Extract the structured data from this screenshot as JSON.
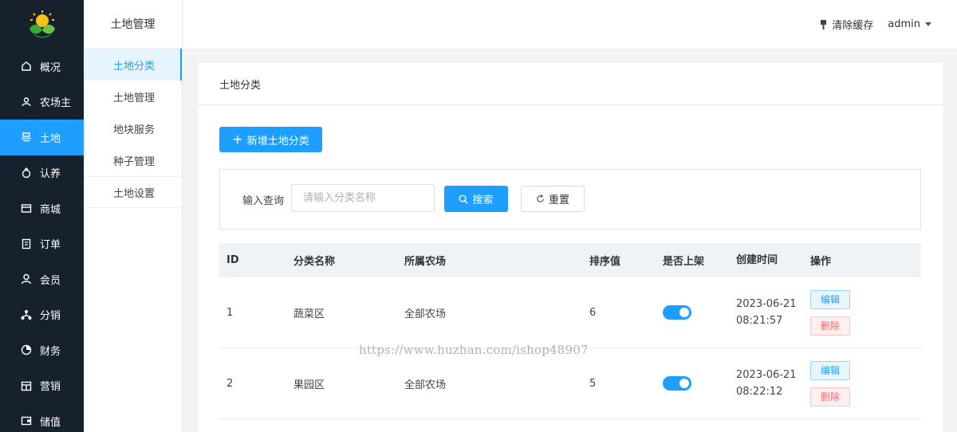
{
  "colors": {
    "sidebar_bg": "#16212d",
    "accent": "#1e9fff",
    "danger": "#f56c6c"
  },
  "sidebar": {
    "items": [
      {
        "label": "概况",
        "icon": "home-icon",
        "active": false
      },
      {
        "label": "农场主",
        "icon": "farmer-icon",
        "active": false
      },
      {
        "label": "土地",
        "icon": "land-icon",
        "active": true
      },
      {
        "label": "认养",
        "icon": "adopt-icon",
        "active": false
      },
      {
        "label": "商城",
        "icon": "shop-icon",
        "active": false
      },
      {
        "label": "订单",
        "icon": "order-icon",
        "active": false
      },
      {
        "label": "会员",
        "icon": "member-icon",
        "active": false
      },
      {
        "label": "分销",
        "icon": "distribution-icon",
        "active": false
      },
      {
        "label": "财务",
        "icon": "finance-icon",
        "active": false
      },
      {
        "label": "营销",
        "icon": "marketing-icon",
        "active": false
      },
      {
        "label": "储值",
        "icon": "wallet-icon",
        "active": false
      }
    ]
  },
  "submenu": {
    "title": "土地管理",
    "items": [
      {
        "label": "土地分类",
        "active": true
      },
      {
        "label": "土地管理",
        "active": false
      },
      {
        "label": "地块服务",
        "active": false
      },
      {
        "label": "种子管理",
        "active": false
      },
      {
        "label": "土地设置",
        "active": false
      }
    ]
  },
  "header": {
    "clear_cache": "清除缓存",
    "user": "admin"
  },
  "main": {
    "card_title": "土地分类",
    "add_button": "新增土地分类",
    "search": {
      "label": "输入查询",
      "placeholder": "请输入分类名称",
      "value": "",
      "search_button": "搜索",
      "reset_button": "重置"
    },
    "table": {
      "columns": [
        "ID",
        "分类名称",
        "所属农场",
        "排序值",
        "是否上架",
        "创建时间",
        "操作"
      ],
      "rows": [
        {
          "id": "1",
          "name": "蔬菜区",
          "farm": "全部农场",
          "sort": "6",
          "on_shelf": true,
          "date": "2023-06-21",
          "time": "08:21:57",
          "edit": "编辑",
          "delete": "删除"
        },
        {
          "id": "2",
          "name": "果园区",
          "farm": "全部农场",
          "sort": "5",
          "on_shelf": true,
          "date": "2023-06-21",
          "time": "08:22:12",
          "edit": "编辑",
          "delete": "删除"
        }
      ]
    }
  },
  "watermark": "https://www.huzhan.com/ishop48907"
}
